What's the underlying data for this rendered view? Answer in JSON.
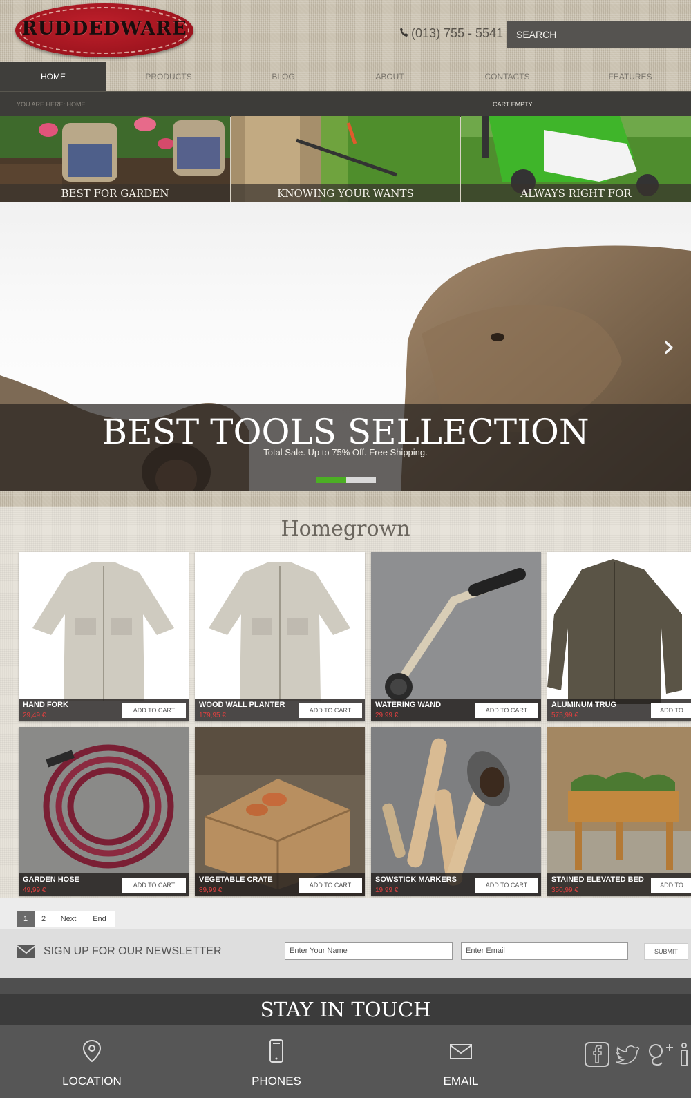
{
  "header": {
    "logo_text": "RUDDEDWARE",
    "phone": "(013) 755 - 5541",
    "search_label": "SEARCH"
  },
  "nav": {
    "items": [
      {
        "label": "HOME",
        "active": true
      },
      {
        "label": "PRODUCTS"
      },
      {
        "label": "BLOG"
      },
      {
        "label": "ABOUT"
      },
      {
        "label": "CONTACTS"
      },
      {
        "label": "FEATURES"
      }
    ]
  },
  "breadcrumb": {
    "text": "YOU ARE HERE: HOME",
    "cart": "CART EMPTY"
  },
  "promos": [
    {
      "label": "BEST FOR GARDEN"
    },
    {
      "label": "KNOWING YOUR WANTS"
    },
    {
      "label": "ALWAYS RIGHT FOR"
    }
  ],
  "hero": {
    "title": "BEST TOOLS SELLECTION",
    "subtitle": "Total Sale. Up to 75% Off. Free Shipping.",
    "slides": 2,
    "active_slide": 1
  },
  "products_section": {
    "title": "Homegrown",
    "add_to_cart_label": "ADD TO CART",
    "items": [
      {
        "name": "HAND FORK",
        "price": "29,49 €"
      },
      {
        "name": "WOOD WALL PLANTER",
        "price": "179,95 €"
      },
      {
        "name": "WATERING WAND",
        "price": "29,99 €"
      },
      {
        "name": "ALUMINUM TRUG",
        "price": "575,99 €"
      },
      {
        "name": "GARDEN HOSE",
        "price": "49,99 €"
      },
      {
        "name": "VEGETABLE CRATE",
        "price": "89,99 €"
      },
      {
        "name": "SOWSTICK MARKERS",
        "price": "19,99 €"
      },
      {
        "name": "STAINED ELEVATED BED",
        "price": "350,99 €"
      }
    ]
  },
  "pagination": {
    "pages": [
      "1",
      "2"
    ],
    "active": "1",
    "next": "Next",
    "end": "End"
  },
  "newsletter": {
    "label": "SIGN UP FOR OUR NEWSLETTER",
    "name_placeholder": "Enter Your Name",
    "email_placeholder": "Enter Email",
    "submit": "SUBMIT"
  },
  "footer": {
    "title": "STAY IN TOUCH",
    "columns": [
      {
        "label": "LOCATION",
        "icon": "map-pin-icon"
      },
      {
        "label": "PHONES",
        "icon": "mobile-phone-icon"
      },
      {
        "label": "EMAIL",
        "icon": "envelope-icon"
      }
    ],
    "social": [
      "facebook-icon",
      "twitter-icon",
      "google-plus-icon",
      "linkedin-icon"
    ]
  }
}
